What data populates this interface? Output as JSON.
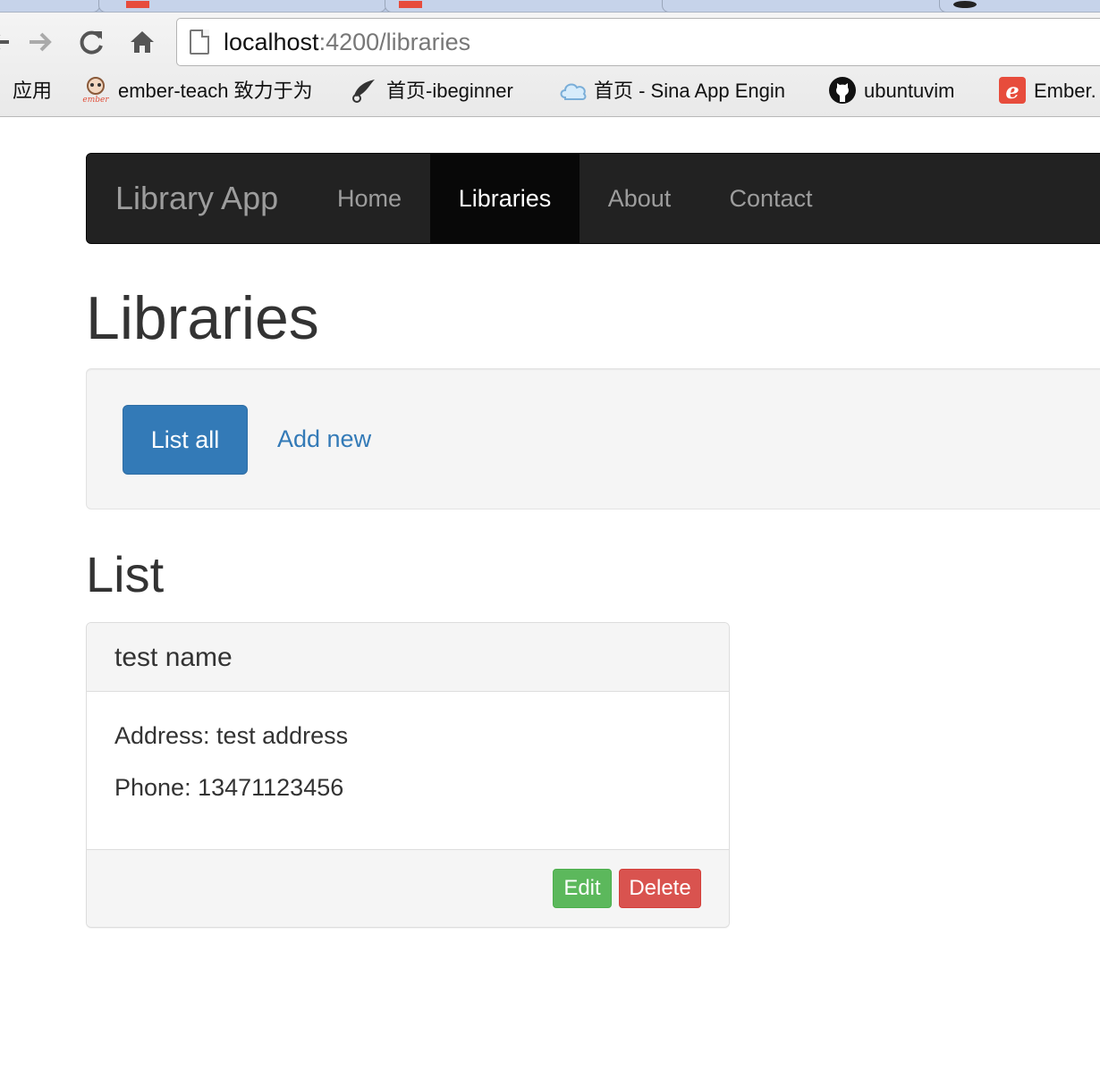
{
  "browser": {
    "url_host": "localhost",
    "url_path": ":4200/libraries",
    "bookmarks": [
      {
        "label": "应用",
        "icon": "apps-icon"
      },
      {
        "label": "ember-teach  致力于为",
        "icon": "ember-teach-icon"
      },
      {
        "label": "首页-ibeginner",
        "icon": "bird-icon"
      },
      {
        "label": "首页 - Sina App Engin",
        "icon": "cloud-icon"
      },
      {
        "label": "ubuntuvim",
        "icon": "github-icon"
      },
      {
        "label": "Ember.",
        "icon": "ember-icon"
      }
    ],
    "accent_tab_color": "#e74c3c"
  },
  "navbar": {
    "brand": "Library App",
    "items": [
      {
        "label": "Home",
        "active": false
      },
      {
        "label": "Libraries",
        "active": true
      },
      {
        "label": "About",
        "active": false
      },
      {
        "label": "Contact",
        "active": false
      }
    ]
  },
  "page": {
    "title": "Libraries",
    "list_all_label": "List all",
    "add_new_label": "Add new",
    "list_heading": "List"
  },
  "library": {
    "name": "test name",
    "address": "Address: test address",
    "phone": "Phone: 13471123456",
    "edit_label": "Edit",
    "delete_label": "Delete"
  },
  "colors": {
    "primary": "#337ab7",
    "success": "#5cb85c",
    "danger": "#d9534f",
    "navbar_bg": "#222222"
  }
}
